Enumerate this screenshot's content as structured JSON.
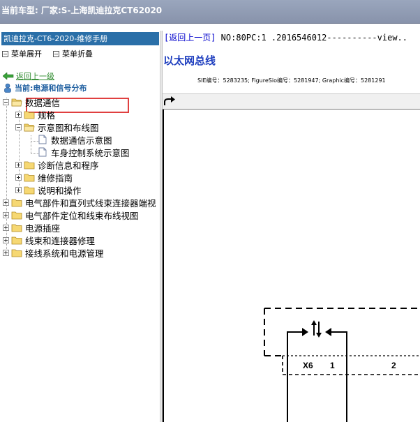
{
  "window": {
    "title": "当前车型:  厂家:S-上海凯迪拉克CT62020"
  },
  "left": {
    "header": "凯迪拉克-CT6-2020-维修手册",
    "expand_label": "菜单展开",
    "collapse_label": "菜单折叠",
    "back_label": "返回上一级",
    "current_label": "当前:电源和信号分布",
    "tree": [
      {
        "label": "数据通信",
        "level": 0,
        "state": "open"
      },
      {
        "label": "规格",
        "level": 1,
        "state": "closed"
      },
      {
        "label": "示意图和布线图",
        "level": 1,
        "state": "open"
      },
      {
        "label": "数据通信示意图",
        "level": 2,
        "state": "doc",
        "selected": true
      },
      {
        "label": "车身控制系统示意图",
        "level": 2,
        "state": "doc"
      },
      {
        "label": "诊断信息和程序",
        "level": 1,
        "state": "closed"
      },
      {
        "label": "维修指南",
        "level": 1,
        "state": "closed"
      },
      {
        "label": "说明和操作",
        "level": 1,
        "state": "closed"
      },
      {
        "label": "电气部件和直列式线束连接器端视",
        "level": 0,
        "state": "closed"
      },
      {
        "label": "电气部件定位和线束布线视图",
        "level": 0,
        "state": "closed"
      },
      {
        "label": "电源插座",
        "level": 0,
        "state": "closed"
      },
      {
        "label": "线束和连接器修理",
        "level": 0,
        "state": "closed"
      },
      {
        "label": "接线系统和电源管理",
        "level": 0,
        "state": "closed"
      }
    ]
  },
  "right": {
    "back_link": "[返回上一页]",
    "nav_info": " NO:80PC:1 .2016546012----------view..",
    "doc_title": "以太网总线",
    "ids_text": "SIE编号：5283235;  FigureSio编号：5281947;  Graphic编号：5281291",
    "diagram": {
      "connector": "X6",
      "pin1": "1",
      "pin2": "2"
    }
  }
}
